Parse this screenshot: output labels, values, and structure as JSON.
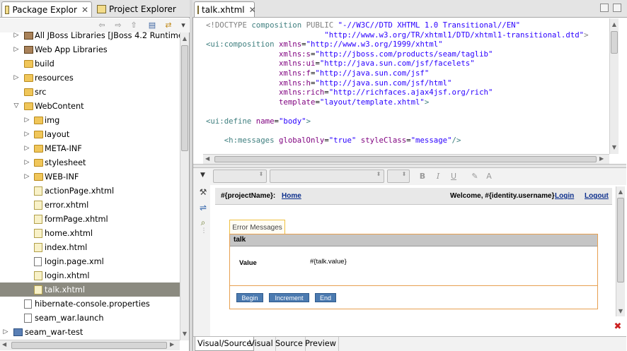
{
  "left_panel": {
    "tabs": [
      {
        "label": "Package Explor"
      },
      {
        "label": "Project Explorer"
      }
    ],
    "close_glyph": "✕",
    "tree": [
      {
        "label": "All JBoss Libraries [JBoss 4.2 Runtime]",
        "icon": "library-icon"
      },
      {
        "label": "Web App Libraries",
        "icon": "library-icon"
      },
      {
        "label": "build",
        "icon": "folder-icon"
      },
      {
        "label": "resources",
        "icon": "folder-icon"
      },
      {
        "label": "src",
        "icon": "folder-icon"
      },
      {
        "label": "WebContent",
        "icon": "folder-icon"
      },
      {
        "label": "img",
        "icon": "folder-icon"
      },
      {
        "label": "layout",
        "icon": "folder-icon"
      },
      {
        "label": "META-INF",
        "icon": "folder-icon"
      },
      {
        "label": "stylesheet",
        "icon": "folder-icon"
      },
      {
        "label": "WEB-INF",
        "icon": "folder-icon"
      },
      {
        "label": "actionPage.xhtml",
        "icon": "xhtml-file-icon"
      },
      {
        "label": "error.xhtml",
        "icon": "xhtml-file-icon"
      },
      {
        "label": "formPage.xhtml",
        "icon": "xhtml-file-icon"
      },
      {
        "label": "home.xhtml",
        "icon": "xhtml-file-icon"
      },
      {
        "label": "index.html",
        "icon": "xhtml-file-icon"
      },
      {
        "label": "login.page.xml",
        "icon": "xml-file-icon"
      },
      {
        "label": "login.xhtml",
        "icon": "xhtml-file-icon"
      },
      {
        "label": "talk.xhtml",
        "icon": "xhtml-file-icon",
        "selected": true
      },
      {
        "label": "hibernate-console.properties",
        "icon": "properties-file-icon"
      },
      {
        "label": "seam_war.launch",
        "icon": "launch-file-icon"
      },
      {
        "label": "seam_war-test",
        "icon": "project-icon"
      }
    ]
  },
  "editor": {
    "tab_label": "talk.xhtml",
    "source_lines": [
      [
        [
          "t-doc",
          "<!DOCTYPE "
        ],
        [
          "t-tag",
          "composition "
        ],
        [
          "t-doc",
          "PUBLIC "
        ],
        [
          "t-val",
          "\"-//W3C//DTD XHTML 1.0 Transitional//EN\""
        ]
      ],
      [
        [
          "t-val",
          "                          \"http://www.w3.org/TR/xhtml1/DTD/xhtml1-transitional.dtd\""
        ],
        [
          "t-doc",
          ">"
        ]
      ],
      [
        [
          "t-tag",
          "<ui:composition "
        ],
        [
          "t-attr",
          "xmlns"
        ],
        [
          "",
          "="
        ],
        [
          "t-val",
          "\"http://www.w3.org/1999/xhtml\""
        ]
      ],
      [
        [
          "t-attr",
          "                xmlns:s"
        ],
        [
          "",
          "="
        ],
        [
          "t-val",
          "\"http://jboss.com/products/seam/taglib\""
        ]
      ],
      [
        [
          "t-attr",
          "                xmlns:ui"
        ],
        [
          "",
          "="
        ],
        [
          "t-val",
          "\"http://java.sun.com/jsf/facelets\""
        ]
      ],
      [
        [
          "t-attr",
          "                xmlns:f"
        ],
        [
          "",
          "="
        ],
        [
          "t-val",
          "\"http://java.sun.com/jsf\""
        ]
      ],
      [
        [
          "t-attr",
          "                xmlns:h"
        ],
        [
          "",
          "="
        ],
        [
          "t-val",
          "\"http://java.sun.com/jsf/html\""
        ]
      ],
      [
        [
          "t-attr",
          "                xmlns:rich"
        ],
        [
          "",
          "="
        ],
        [
          "t-val",
          "\"http://richfaces.ajax4jsf.org/rich\""
        ]
      ],
      [
        [
          "t-attr",
          "                template"
        ],
        [
          "",
          "="
        ],
        [
          "t-val",
          "\"layout/template.xhtml\""
        ],
        [
          "t-tag",
          ">"
        ]
      ],
      [],
      [
        [
          "t-tag",
          "<ui:define "
        ],
        [
          "t-attr",
          "name"
        ],
        [
          "",
          "="
        ],
        [
          "t-val",
          "\"body\""
        ],
        [
          "t-tag",
          ">"
        ]
      ],
      [],
      [
        [
          "t-tag",
          "    <h:messages "
        ],
        [
          "t-attr",
          "globalOnly"
        ],
        [
          "",
          "="
        ],
        [
          "t-val",
          "\"true\" "
        ],
        [
          "t-attr",
          "styleClass"
        ],
        [
          "",
          "="
        ],
        [
          "t-val",
          "\"message\""
        ],
        [
          "t-tag",
          "/>"
        ]
      ]
    ]
  },
  "format_toolbar": {
    "bold": "B",
    "italic": "I",
    "underline": "U"
  },
  "visual_preview": {
    "header": {
      "project": "#{projectName}:",
      "home_link": "Home",
      "welcome": "Welcome, #{identity.username}",
      "login_link": "Login",
      "logout_link": "Logout"
    },
    "error_messages": "Error Messages",
    "panel_title": "talk",
    "field_label": "Value",
    "field_value": "#{talk.value}",
    "buttons": [
      "Begin",
      "Increment",
      "End"
    ]
  },
  "bottom_tabs": [
    {
      "label": "Visual/Source",
      "active": true
    },
    {
      "label": "Visual"
    },
    {
      "label": "Source"
    },
    {
      "label": "Preview"
    }
  ],
  "colors": {
    "selection": "#8b8a80",
    "xml_tag": "#3f7f7f",
    "xml_attr": "#7f007f",
    "xml_value": "#2a00ff",
    "button_blue": "#4b7ab0",
    "panel_border": "#e7a050"
  }
}
